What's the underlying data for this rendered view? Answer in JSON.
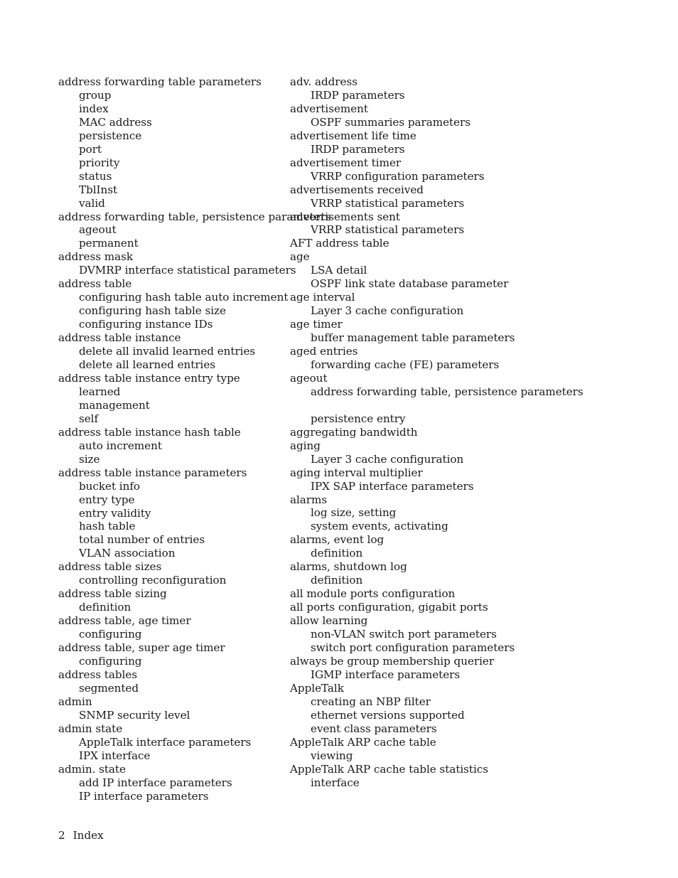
{
  "document": {
    "type": "book-index",
    "footer": {
      "page_number": "2",
      "label": "Index"
    }
  },
  "columns": [
    {
      "name": "left-column",
      "entries": [
        {
          "term": "address forwarding table parameters",
          "subentries": [
            "group",
            "index",
            "MAC address",
            "persistence",
            "port",
            "priority",
            "status",
            "TblInst",
            "valid"
          ]
        },
        {
          "term": "address forwarding table, persistence parameters",
          "subentries": [
            "ageout",
            "permanent"
          ]
        },
        {
          "term": "address mask",
          "subentries": [
            "DVMRP interface statistical parameters"
          ]
        },
        {
          "term": "address table",
          "subentries": [
            "configuring hash table auto increment",
            "configuring hash table size",
            "configuring instance IDs"
          ]
        },
        {
          "term": "address table instance",
          "subentries": [
            "delete all invalid learned entries",
            "delete all learned entries"
          ]
        },
        {
          "term": "address table instance entry type",
          "subentries": [
            "learned",
            "management",
            "self"
          ]
        },
        {
          "term": "address table instance hash table",
          "subentries": [
            "auto increment",
            "size"
          ]
        },
        {
          "term": "address table instance parameters",
          "subentries": [
            "bucket info",
            "entry type",
            "entry validity",
            "hash table",
            "total number of entries",
            "VLAN association"
          ]
        },
        {
          "term": "address table sizes",
          "subentries": [
            "controlling reconfiguration"
          ]
        },
        {
          "term": "address table sizing",
          "subentries": [
            "definition"
          ]
        },
        {
          "term": "address table, age timer",
          "subentries": [
            "configuring"
          ]
        },
        {
          "term": "address table, super age timer",
          "subentries": [
            "configuring"
          ]
        },
        {
          "term": "address tables",
          "subentries": [
            "segmented"
          ]
        },
        {
          "term": "admin",
          "subentries": [
            "SNMP security level"
          ]
        },
        {
          "term": "admin state",
          "subentries": [
            "AppleTalk interface parameters",
            "IPX interface"
          ]
        },
        {
          "term": "admin. state",
          "subentries": [
            "add IP interface parameters",
            "IP interface parameters"
          ]
        }
      ]
    },
    {
      "name": "right-column",
      "entries": [
        {
          "term": "adv. address",
          "subentries": [
            "IRDP parameters"
          ]
        },
        {
          "term": "advertisement",
          "subentries": [
            "OSPF summaries parameters"
          ]
        },
        {
          "term": "advertisement life time",
          "subentries": [
            "IRDP parameters"
          ]
        },
        {
          "term": "advertisement timer",
          "subentries": [
            "VRRP configuration parameters"
          ]
        },
        {
          "term": "advertisements received",
          "subentries": [
            "VRRP statistical parameters"
          ]
        },
        {
          "term": "advertisements sent",
          "subentries": [
            "VRRP statistical parameters"
          ]
        },
        {
          "term": "AFT address table",
          "subentries": []
        },
        {
          "term": "age",
          "subentries": [
            "LSA detail",
            "OSPF link state database parameter"
          ]
        },
        {
          "term": "age interval",
          "subentries": [
            "Layer 3 cache configuration"
          ]
        },
        {
          "term": "age timer",
          "subentries": [
            "buffer management table parameters"
          ]
        },
        {
          "term": "aged entries",
          "subentries": [
            "forwarding cache (FE) parameters"
          ]
        },
        {
          "term": "ageout",
          "subentries": [
            "address forwarding table, persistence parameters",
            "",
            "persistence entry"
          ]
        },
        {
          "term": "aggregating bandwidth",
          "subentries": []
        },
        {
          "term": "aging",
          "subentries": [
            "Layer 3 cache configuration"
          ]
        },
        {
          "term": "aging interval multiplier",
          "subentries": [
            "IPX SAP interface parameters"
          ]
        },
        {
          "term": "alarms",
          "subentries": [
            "log size, setting",
            "system events, activating"
          ]
        },
        {
          "term": "alarms, event log",
          "subentries": [
            "definition"
          ]
        },
        {
          "term": "alarms, shutdown log",
          "subentries": [
            "definition"
          ]
        },
        {
          "term": "all module ports configuration",
          "subentries": []
        },
        {
          "term": "all ports configuration, gigabit ports",
          "subentries": []
        },
        {
          "term": "allow learning",
          "subentries": [
            "non-VLAN switch port parameters",
            "switch port configuration parameters"
          ]
        },
        {
          "term": "always be group membership querier",
          "subentries": [
            "IGMP interface parameters"
          ]
        },
        {
          "term": "AppleTalk",
          "subentries": [
            "creating an NBP filter",
            "ethernet versions supported",
            "event class parameters"
          ]
        },
        {
          "term": "AppleTalk ARP cache table",
          "subentries": [
            "viewing"
          ]
        },
        {
          "term": "AppleTalk ARP cache table statistics",
          "subentries": [
            "interface"
          ]
        }
      ]
    }
  ]
}
